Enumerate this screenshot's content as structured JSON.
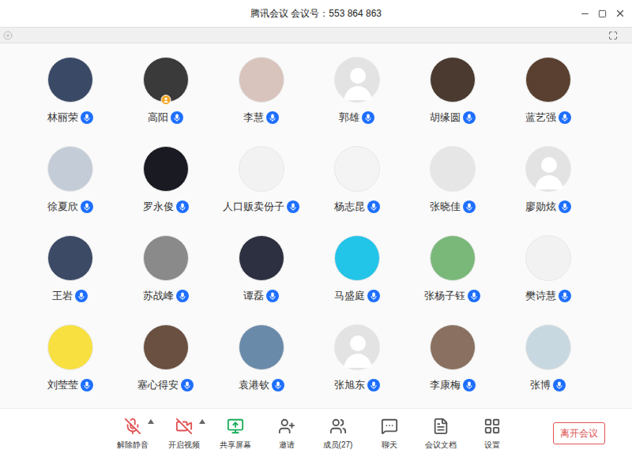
{
  "window": {
    "title": "腾讯会议 会议号：553 864 863"
  },
  "participants": [
    {
      "name": "林丽荣",
      "avatar": "photo",
      "color": "#3a4a66",
      "host": false,
      "mic_on": true
    },
    {
      "name": "高阳",
      "avatar": "photo",
      "color": "#3a3a3a",
      "host": true,
      "mic_on": true
    },
    {
      "name": "李慧",
      "avatar": "photo",
      "color": "#d8c4bc",
      "host": false,
      "mic_on": true
    },
    {
      "name": "郭雄",
      "avatar": "default",
      "color": "#e3e3e3",
      "host": false,
      "mic_on": true
    },
    {
      "name": "胡缘圆",
      "avatar": "photo",
      "color": "#4a3a30",
      "host": false,
      "mic_on": true
    },
    {
      "name": "蓝艺强",
      "avatar": "photo",
      "color": "#5a4030",
      "host": false,
      "mic_on": true
    },
    {
      "name": "徐夏欣",
      "avatar": "photo",
      "color": "#c4ccd8",
      "host": false,
      "mic_on": true
    },
    {
      "name": "罗永俊",
      "avatar": "photo",
      "color": "#1a1a22",
      "host": false,
      "mic_on": true
    },
    {
      "name": "人口贩卖份子",
      "avatar": "photo",
      "color": "#f2f2f2",
      "host": false,
      "mic_on": true
    },
    {
      "name": "杨志昆",
      "avatar": "photo",
      "color": "#f4f4f4",
      "host": false,
      "mic_on": true
    },
    {
      "name": "张晓佳",
      "avatar": "photo",
      "color": "#e6e6e6",
      "host": false,
      "mic_on": true
    },
    {
      "name": "廖勋炫",
      "avatar": "default",
      "color": "#e3e3e3",
      "host": false,
      "mic_on": true
    },
    {
      "name": "王岩",
      "avatar": "photo",
      "color": "#3c4a66",
      "host": false,
      "mic_on": true
    },
    {
      "name": "苏战峰",
      "avatar": "photo",
      "color": "#8a8a8a",
      "host": false,
      "mic_on": true
    },
    {
      "name": "谭磊",
      "avatar": "photo",
      "color": "#2c3040",
      "host": false,
      "mic_on": true
    },
    {
      "name": "马盛庭",
      "avatar": "photo",
      "color": "#22c4e8",
      "host": false,
      "mic_on": true
    },
    {
      "name": "张杨子钰",
      "avatar": "photo",
      "color": "#7ab87a",
      "host": false,
      "mic_on": true
    },
    {
      "name": "樊诗慧",
      "avatar": "photo",
      "color": "#f2f2f2",
      "host": false,
      "mic_on": true
    },
    {
      "name": "刘莹莹",
      "avatar": "photo",
      "color": "#f8e040",
      "host": false,
      "mic_on": true
    },
    {
      "name": "塞心得安",
      "avatar": "photo",
      "color": "#6a5040",
      "host": false,
      "mic_on": true
    },
    {
      "name": "袁港钦",
      "avatar": "photo",
      "color": "#6a8aaa",
      "host": false,
      "mic_on": true
    },
    {
      "name": "张旭东",
      "avatar": "default",
      "color": "#e3e3e3",
      "host": false,
      "mic_on": true
    },
    {
      "name": "李康梅",
      "avatar": "photo",
      "color": "#8a7060",
      "host": false,
      "mic_on": true
    },
    {
      "name": "张博",
      "avatar": "photo",
      "color": "#c8d8e0",
      "host": false,
      "mic_on": true
    }
  ],
  "toolbar": [
    {
      "label": "解除静音",
      "kind": "mic",
      "off": true,
      "dropdown": true
    },
    {
      "label": "开启视频",
      "kind": "video",
      "off": true,
      "dropdown": true
    },
    {
      "label": "共享屏幕",
      "kind": "share",
      "off": false,
      "dropdown": false
    },
    {
      "label": "邀请",
      "kind": "invite",
      "off": false,
      "dropdown": false
    },
    {
      "label": "成员(27)",
      "kind": "members",
      "off": false,
      "dropdown": false
    },
    {
      "label": "聊天",
      "kind": "chat",
      "off": false,
      "dropdown": false
    },
    {
      "label": "会议文档",
      "kind": "docs",
      "off": false,
      "dropdown": false
    },
    {
      "label": "设置",
      "kind": "settings",
      "off": false,
      "dropdown": false
    }
  ],
  "leave_button": "离开会议"
}
